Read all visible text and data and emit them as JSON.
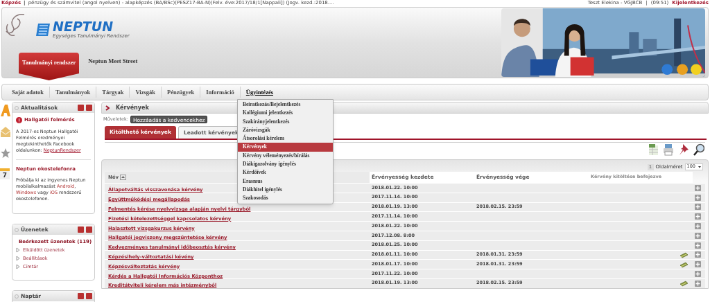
{
  "top_bar": {
    "training_label": "Képzés",
    "separator": "|",
    "training": "pénzügy és számvitel (angol nyelven) - alapképzés (BA/BSc)(PESZ17-BA-N)(Felv. éve:2017/18/1[Nappali]) (Jogv. kezd.:2018....",
    "user": "Teszt Elekina - VGJBCB",
    "user_separator": "|",
    "time": "(09:51)",
    "logout": "Kijelentkezés"
  },
  "header": {
    "logo": "NEPTUN",
    "logo_subtitle": "Egységes Tanulmányi Rendszer",
    "tabs": [
      {
        "label": "Tanulmányi rendszer",
        "selected": true
      },
      {
        "label": "Neptun Meet Street",
        "selected": false
      }
    ]
  },
  "menu": [
    {
      "label": "Saját adatok",
      "open": false
    },
    {
      "label": "Tanulmányok",
      "open": false
    },
    {
      "label": "Tárgyak",
      "open": false
    },
    {
      "label": "Vizsgák",
      "open": false
    },
    {
      "label": "Pénzügyek",
      "open": false
    },
    {
      "label": "Információ",
      "open": false
    },
    {
      "label": "Ügyintézés",
      "open": true
    }
  ],
  "dropdown": [
    {
      "label": "Beiratkozás/Bejelentkezés",
      "selected": false
    },
    {
      "label": "Kollégiumi jelentkezés",
      "selected": false
    },
    {
      "label": "Szakirányjelentkezés",
      "selected": false
    },
    {
      "label": "Záróvizsgák",
      "selected": false
    },
    {
      "label": "Átsorolási kérelem",
      "selected": false
    },
    {
      "label": "Kérvények",
      "selected": true
    },
    {
      "label": "Kérvény véleményezés/bírálás",
      "selected": false
    },
    {
      "label": "Diákigazolvány igénylés",
      "selected": false
    },
    {
      "label": "Kérdőívek",
      "selected": false
    },
    {
      "label": "Erasmus",
      "selected": false
    },
    {
      "label": "Diákhitel igénylés",
      "selected": false
    },
    {
      "label": "Szakosodás",
      "selected": false
    }
  ],
  "left_strip": {
    "calendar_day": "7"
  },
  "sidebar": [
    {
      "title": "Aktualitások",
      "kind": "news",
      "items": [
        {
          "heading": "Hallgatói felmérés",
          "alert": true,
          "text": "A 2017-es Neptun Hallgatói Felmérés eredményei megtekinthetők Facebook oldalunkon:",
          "link": "NeptunRendszer"
        },
        {
          "heading": "Neptun okostelefonra",
          "alert": false,
          "text": "Próbálja ki az ingyenes Neptun mobilalkalmazást **Android**, **Windows** vagy **iOS** rendszerű okostelefonon."
        }
      ]
    },
    {
      "title": "Üzenetek",
      "kind": "links",
      "items": [
        {
          "label": "Beérkezett üzenetek (119)",
          "selected": true
        },
        {
          "label": "Elküldött üzenetek",
          "selected": false
        },
        {
          "label": "Beállítások",
          "selected": false
        },
        {
          "label": "Címtár",
          "selected": false
        }
      ]
    },
    {
      "title": "Naptár",
      "kind": "calendar"
    }
  ],
  "main": {
    "title": "Kérvények",
    "actions_label": "Műveletek:",
    "favorite_button": "Hozzáadás a kedvencekhez",
    "tabs": [
      {
        "label": "Kitölthető kérvények",
        "selected": true
      },
      {
        "label": "Leadott kérvények",
        "selected": false
      }
    ],
    "pager": {
      "page": "1",
      "size_label": "Oldalméret",
      "size": "100"
    },
    "table": {
      "columns": [
        "Név",
        "Érvényesség kezdete",
        "Érvényesség vége",
        "Kérvény kitöltése befejezve"
      ],
      "rows": [
        {
          "name": "Állapotváltás visszavonása kérvény",
          "start": "2018.01.22. 10:00",
          "fee": false
        },
        {
          "name": "Együttműködési megállapodás",
          "start": "2017.11.14. 10:00",
          "fee": false
        },
        {
          "name": "Felmentés kérése nyelvvizsga alapján nyelvi tárgyból",
          "start": "2018.01.19. 13:00",
          "end": "2018.02.15. 23:59",
          "fee": false
        },
        {
          "name": "Fizetési kötelezettséggel kapcsolatos kérvény",
          "start": "2017.11.14. 10:00",
          "fee": false
        },
        {
          "name": "Halasztott vizsgakurzus kérvény",
          "start": "2018.01.22. 10:00",
          "fee": false
        },
        {
          "name": "Hallgatói jogviszony megszűntetése kérvény",
          "start": "2017.12.08. 8:00",
          "fee": false
        },
        {
          "name": "Kedvezményes tanulmányi időbeosztás kérvény",
          "start": "2018.01.25. 10:00",
          "fee": false
        },
        {
          "name": "Képzésihely-változtatási kévény",
          "start": "2018.01.11. 10:00",
          "end": "2018.01.31. 23:59",
          "fee": true
        },
        {
          "name": "Képzésváltoztatás kérvény",
          "start": "2018.01.17. 10:00",
          "end": "2018.01.31. 23:59",
          "fee": true
        },
        {
          "name": "Kérdés a Hallgatói Információs Központhoz",
          "start": "2017.11.22. 10:00",
          "fee": false
        },
        {
          "name": "Kreditátviteli kérelem más intézményből",
          "start": "2018.01.19. 13:00",
          "end": "2018.02.15. 23:59",
          "fee": true
        }
      ]
    }
  }
}
